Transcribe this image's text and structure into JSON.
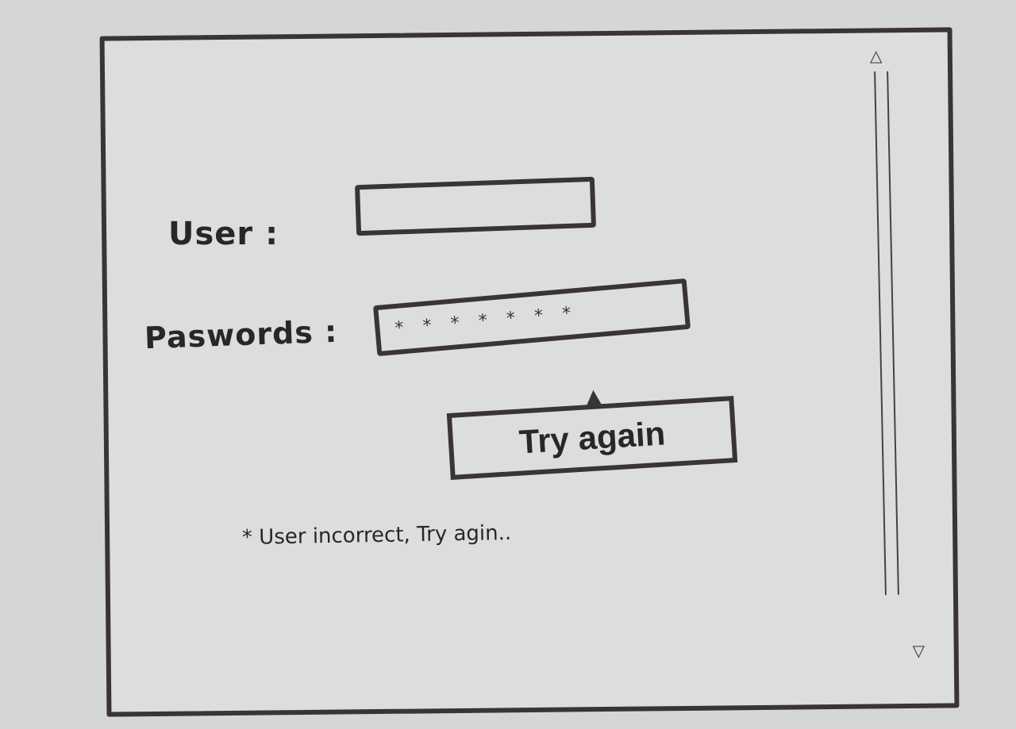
{
  "form": {
    "user_label": "User :",
    "user_value": "",
    "password_label": "Paswords :",
    "password_value": "*******",
    "submit_label": "Try again",
    "error_message": "* User incorrect, Try agin.."
  },
  "scrollbar": {
    "up_icon": "scroll-up-arrow",
    "down_icon": "scroll-down-arrow",
    "up_glyph": "◁",
    "down_glyph": "◁"
  }
}
